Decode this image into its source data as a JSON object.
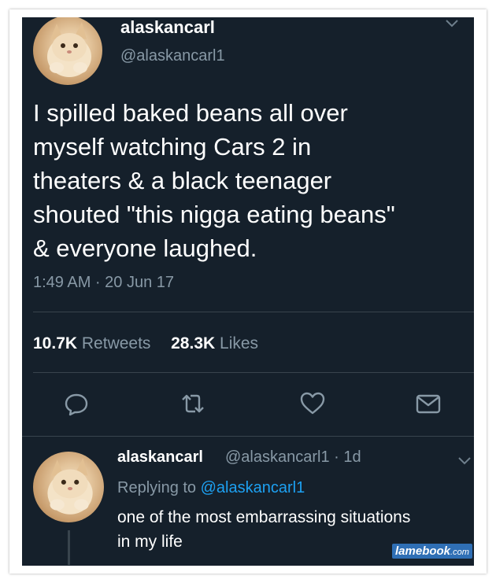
{
  "tweet": {
    "display_name": "alaskancarl",
    "handle": "@alaskancarl1",
    "text": "I spilled baked beans all over\nmyself watching Cars 2 in\ntheaters & a black teenager\nshouted \"this nigga eating beans\"\n& everyone laughed.",
    "timestamp": "1:49 AM · 20 Jun 17",
    "retweets_count": "10.7K",
    "retweets_label": "Retweets",
    "likes_count": "28.3K",
    "likes_label": "Likes",
    "actions": [
      "reply-icon",
      "retweet-icon",
      "like-icon",
      "message-icon"
    ]
  },
  "reply": {
    "display_name": "alaskancarl",
    "handle_time": "@alaskancarl1 · 1d",
    "replying_prefix": "Replying to",
    "replying_to": "@alaskancarl1",
    "text": "one of the most embarrassing situations\nin my life"
  },
  "watermark": {
    "brand": "lamebook",
    "suffix": ".com"
  },
  "colors": {
    "background": "#15202b",
    "text": "#ffffff",
    "secondary": "#8899a6",
    "accent": "#1da1f2",
    "divider": "#38444d"
  }
}
